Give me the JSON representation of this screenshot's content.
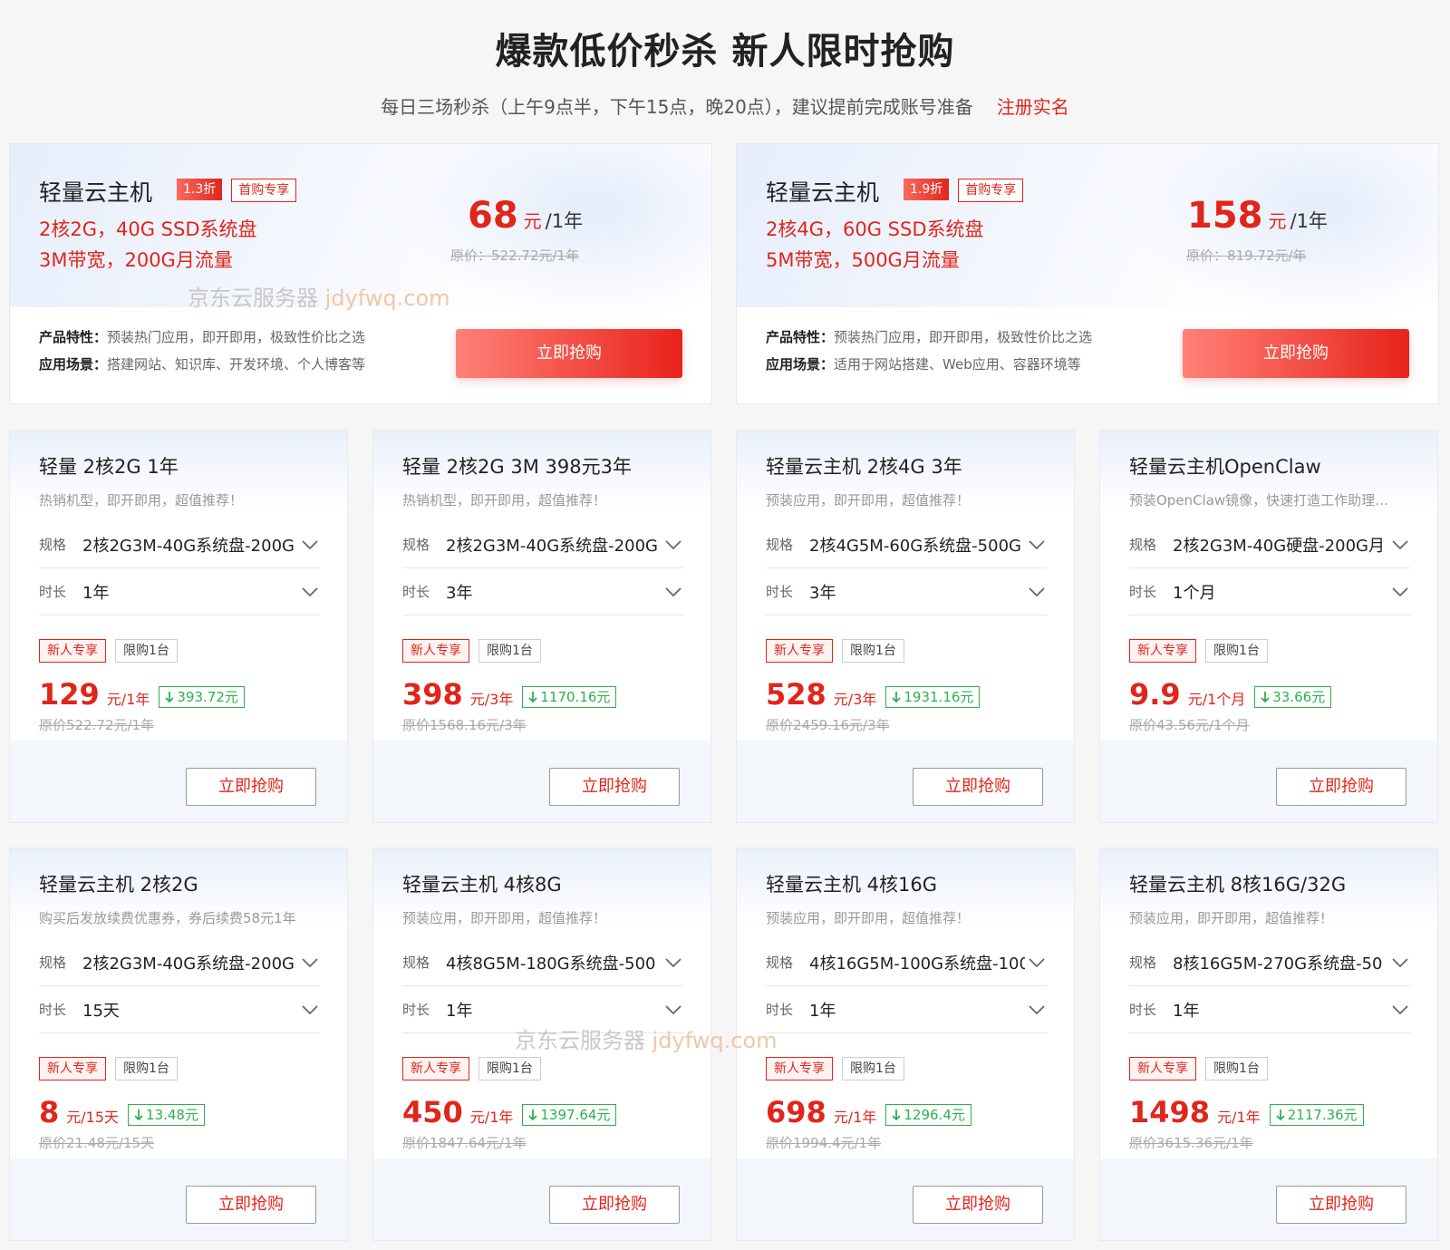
{
  "header": {
    "title": "爆款低价秒杀 新人限时抢购",
    "subtitle": "每日三场秒杀（上午9点半，下午15点，晚20点），建议提前完成账号准备",
    "register_link": "注册实名"
  },
  "featured": [
    {
      "title": "轻量云主机",
      "discount": "1.3折",
      "first_badge": "首购专享",
      "spec_line1": "2核2G，40G SSD系统盘",
      "spec_line2": "3M带宽，200G月流量",
      "price": "68",
      "unit": "元",
      "period": "/1年",
      "original": "原价：522.72元/1年",
      "features_label": "产品特性：",
      "features": "预装热门应用，即开即用，极致性价比之选",
      "scenes_label": "应用场景：",
      "scenes": "搭建网站、知识库、开发环境、个人博客等",
      "button": "立即抢购"
    },
    {
      "title": "轻量云主机",
      "discount": "1.9折",
      "first_badge": "首购专享",
      "spec_line1": "2核4G，60G SSD系统盘",
      "spec_line2": "5M带宽，500G月流量",
      "price": "158",
      "unit": "元",
      "period": "/1年",
      "original": "原价：819.72元/年",
      "features_label": "产品特性：",
      "features": "预装热门应用，即开即用，极致性价比之选",
      "scenes_label": "应用场景：",
      "scenes": "适用于网站搭建、Web应用、容器环境等",
      "button": "立即抢购"
    }
  ],
  "common": {
    "spec_label": "规格",
    "duration_label": "时长",
    "tag_new": "新人专享",
    "tag_limit": "限购1台",
    "button": "立即抢购"
  },
  "cards": [
    {
      "title": "轻量 2核2G 1年",
      "desc": "热销机型，即开即用，超值推荐！",
      "spec": "2核2G3M-40G系统盘-200G",
      "duration": "1年",
      "price": "129",
      "per": "元/1年",
      "save": "393.72元",
      "original": "原价522.72元/1年"
    },
    {
      "title": "轻量 2核2G 3M 398元3年",
      "desc": "热销机型，即开即用，超值推荐！",
      "spec": "2核2G3M-40G系统盘-200G",
      "duration": "3年",
      "price": "398",
      "per": "元/3年",
      "save": "1170.16元",
      "original": "原价1568.16元/3年"
    },
    {
      "title": "轻量云主机 2核4G 3年",
      "desc": "预装应用，即开即用，超值推荐！",
      "spec": "2核4G5M-60G系统盘-500G",
      "duration": "3年",
      "price": "528",
      "per": "元/3年",
      "save": "1931.16元",
      "original": "原价2459.16元/3年"
    },
    {
      "title": "轻量云主机OpenClaw",
      "desc": "预装OpenClaw镜像，快速打造工作助理…",
      "spec": "2核2G3M-40G硬盘-200G月",
      "duration": "1个月",
      "price": "9.9",
      "per": "元/1个月",
      "save": "33.66元",
      "original": "原价43.56元/1个月"
    },
    {
      "title": "轻量云主机 2核2G",
      "desc": "购买后发放续费优惠券，券后续费58元1年",
      "spec": "2核2G3M-40G系统盘-200G",
      "duration": "15天",
      "price": "8",
      "per": "元/15天",
      "save": "13.48元",
      "original": "原价21.48元/15天"
    },
    {
      "title": "轻量云主机 4核8G",
      "desc": "预装应用，即开即用，超值推荐！",
      "spec": "4核8G5M-180G系统盘-500",
      "duration": "1年",
      "price": "450",
      "per": "元/1年",
      "save": "1397.64元",
      "original": "原价1847.64元/1年"
    },
    {
      "title": "轻量云主机 4核16G",
      "desc": "预装应用，即开即用，超值推荐！",
      "spec": "4核16G5M-100G系统盘-100",
      "duration": "1年",
      "price": "698",
      "per": "元/1年",
      "save": "1296.4元",
      "original": "原价1994.4元/1年"
    },
    {
      "title": "轻量云主机 8核16G/32G",
      "desc": "预装应用，即开即用，超值推荐！",
      "spec": "8核16G5M-270G系统盘-50",
      "duration": "1年",
      "price": "1498",
      "per": "元/1年",
      "save": "2117.36元",
      "original": "原价3615.36元/1年"
    }
  ],
  "watermark": {
    "cn": "京东云服务器",
    "en": "jdyfwq.com"
  },
  "icons": {
    "dropdown": "chevron-down-icon",
    "save": "arrow-down-icon"
  },
  "colors": {
    "accent": "#e1251b",
    "save_green": "#2bb24c"
  }
}
